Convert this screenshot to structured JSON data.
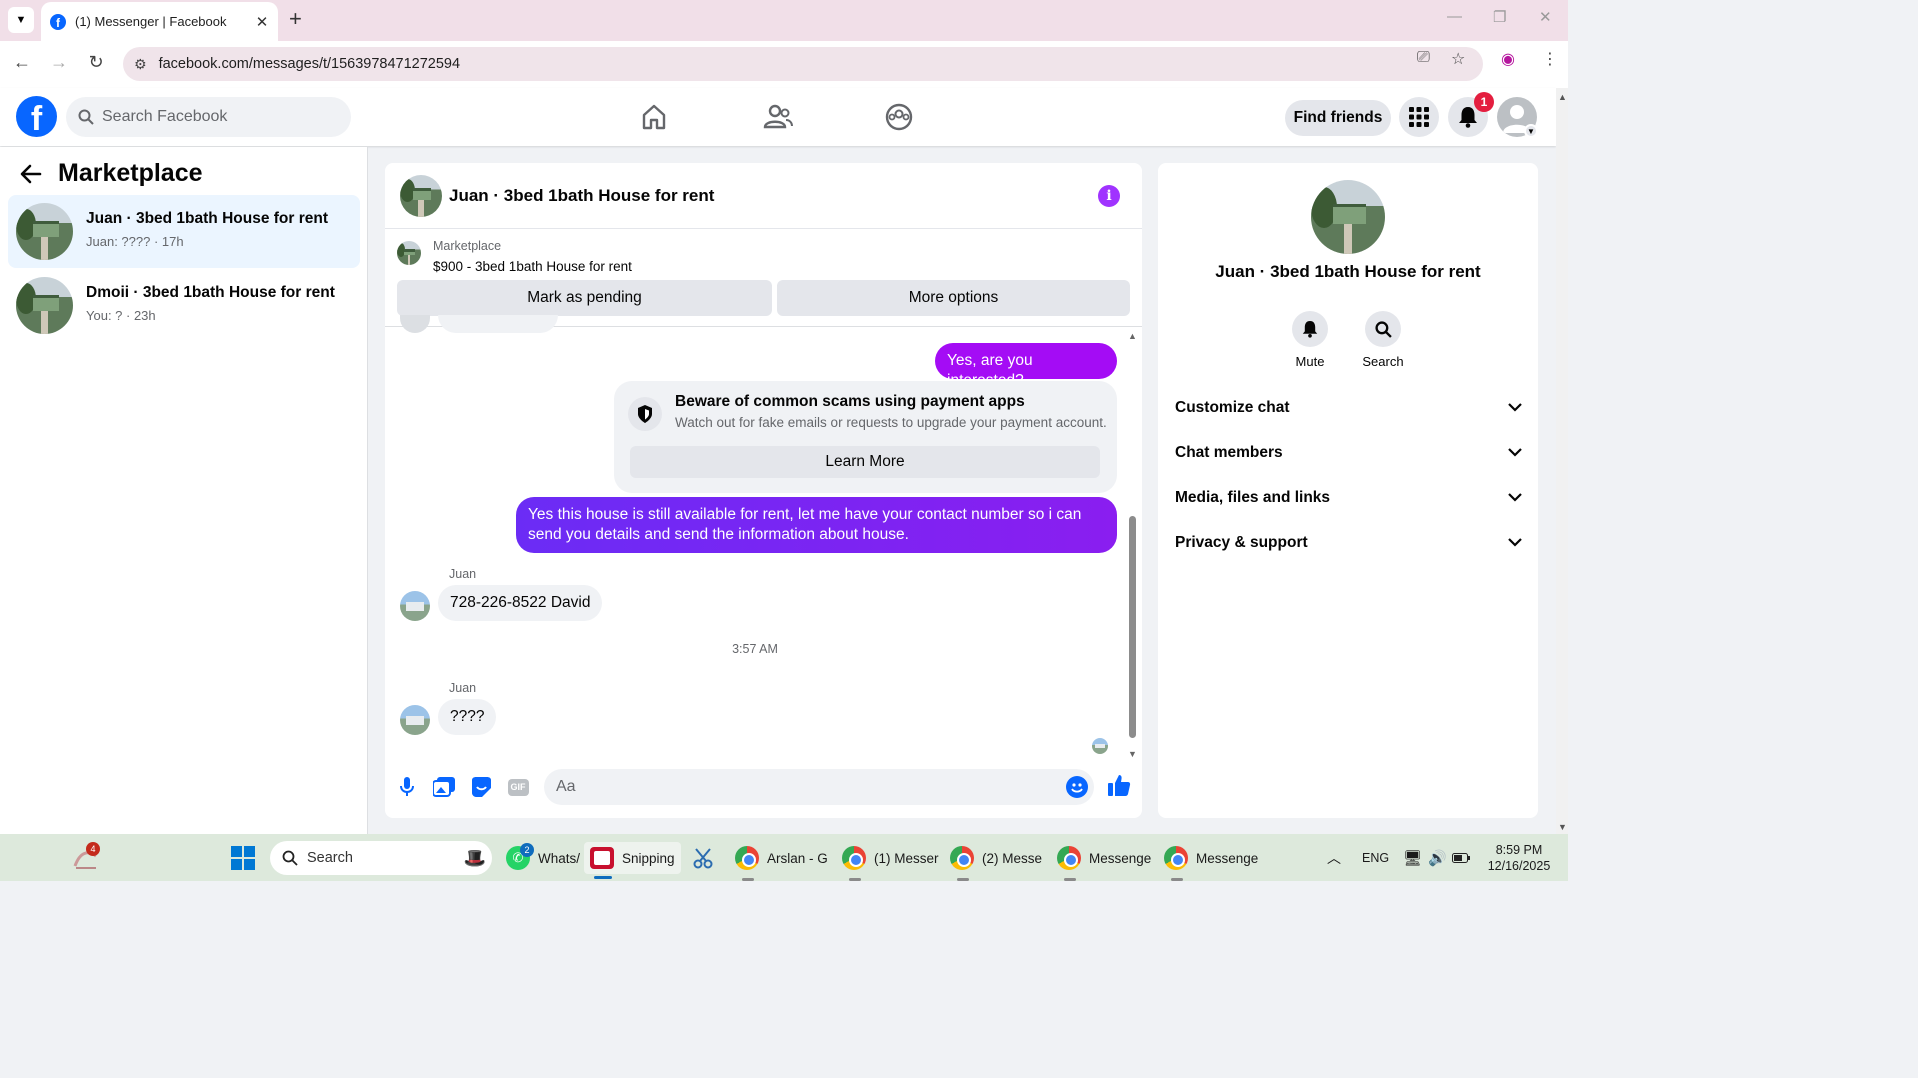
{
  "browser": {
    "tab_title": "(1) Messenger | Facebook",
    "url": "facebook.com/messages/t/1563978471272594"
  },
  "header": {
    "search_placeholder": "Search Facebook",
    "find_friends": "Find friends",
    "notification_count": "1"
  },
  "left_panel": {
    "title": "Marketplace",
    "conversations": [
      {
        "name": "Juan · 3bed 1bath House for rent",
        "preview": "Juan: ???? · 17h",
        "active": true
      },
      {
        "name": "Dmoii · 3bed 1bath House for rent",
        "preview": "You: ? · 23h",
        "active": false
      }
    ]
  },
  "chat": {
    "title": "Juan · 3bed 1bath House for rent",
    "marketplace_label": "Marketplace",
    "listing": "$900 - 3bed 1bath House for rent",
    "mark_pending": "Mark as pending",
    "more_options": "More options",
    "messages": {
      "out_1": "Yes, are you interested?",
      "scam_title": "Beware of common scams using payment apps",
      "scam_text": "Watch out for fake emails or requests to upgrade your payment account.",
      "learn_more": "Learn More",
      "out_2": "Yes this house is still available for rent, let me have your contact number so i can send you details and send the information about house.",
      "sender_1": "Juan",
      "in_1": "728-226-8522 David",
      "time": "3:57 AM",
      "sender_2": "Juan",
      "in_2": "????"
    },
    "composer_placeholder": "Aa"
  },
  "right_panel": {
    "name": "Juan · 3bed 1bath House for rent",
    "mute": "Mute",
    "search": "Search",
    "sections": [
      "Customize chat",
      "Chat members",
      "Media, files and links",
      "Privacy & support"
    ]
  },
  "taskbar": {
    "widgets_badge": "4",
    "search_placeholder": "Search",
    "apps": [
      {
        "label": "Whats/",
        "badge": "2"
      },
      {
        "label": "Snipping"
      },
      {
        "label": "Arslan - G"
      },
      {
        "label": "(1) Messer"
      },
      {
        "label": "(2) Messe"
      },
      {
        "label": "Messenge"
      },
      {
        "label": "Messenge"
      }
    ],
    "language": "ENG",
    "time": "8:59 PM",
    "date": "12/16/2025"
  },
  "colors": {
    "fb_blue": "#0866ff",
    "accent_purple": "#a033ff",
    "outgoing_bubble": "#6b2cf5"
  }
}
